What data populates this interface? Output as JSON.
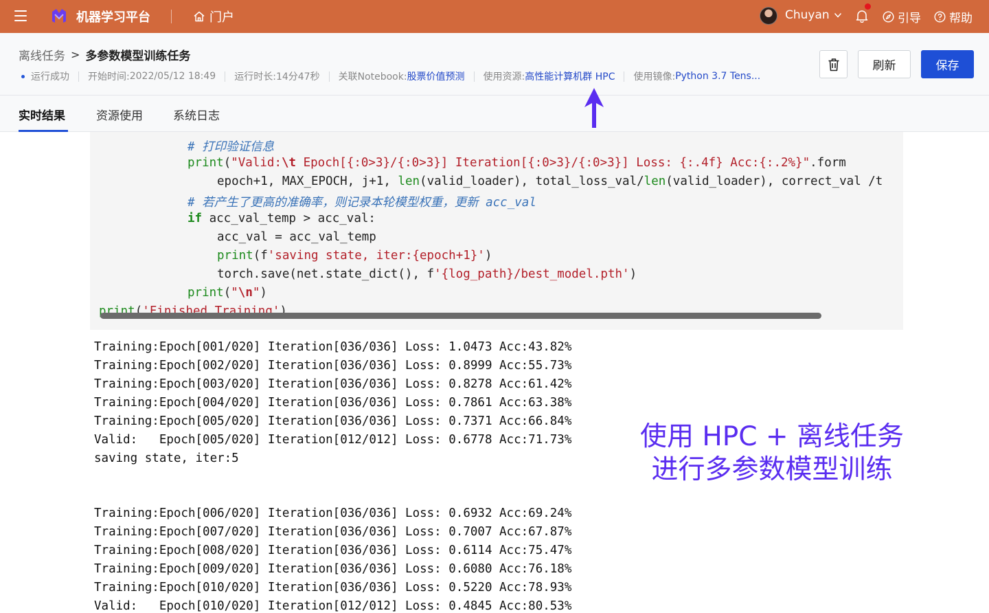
{
  "topbar": {
    "app_title": "机器学习平台",
    "portal_label": "门户",
    "user_name": "Chuyan",
    "guide_label": "引导",
    "help_label": "帮助",
    "accent_color": "#d2693c"
  },
  "header": {
    "breadcrumb_parent": "离线任务",
    "breadcrumb_sep": ">",
    "breadcrumb_current": "多参数模型训练任务",
    "status": "运行成功",
    "start_time_label": "开始时间: ",
    "start_time": "2022/05/12 18:49",
    "duration_label": "运行时长: ",
    "duration": "14分47秒",
    "notebook_label": "关联Notebook: ",
    "notebook": "股票价值预测",
    "resource_label": "使用资源: ",
    "resource": "高性能计算机群 HPC",
    "image_label": "使用镜像: ",
    "image": "Python 3.7 Tens...",
    "refresh_label": "刷新",
    "save_label": "保存"
  },
  "tabs": [
    {
      "label": "实时结果",
      "active": true
    },
    {
      "label": "资源使用",
      "active": false
    },
    {
      "label": "系统日志",
      "active": false
    }
  ],
  "code": {
    "line1": "# 打印验证信息",
    "line2_fn": "print",
    "line2_open": "(",
    "line2_str1": "\"Valid:",
    "line2_esc": "\\t",
    "line2_str2": " Epoch[{:0>3}/{:0>3}] Iteration[{:0>3}/{:0>3}] Loss: {:.4f} Acc:{:.2%}\"",
    "line2_tail": ".form",
    "line3_a": "epoch",
    "line3_b": "+1, MAX_EPOCH, j",
    "line3_c": "+1, ",
    "line3_len1": "len",
    "line3_d": "(valid_loader), total_loss_val/",
    "line3_len2": "len",
    "line3_e": "(valid_loader), correct_val /t",
    "line4": "# 若产生了更高的准确率，则记录本轮模型权重，更新 acc_val",
    "line5_kw": "if",
    "line5_rest": " acc_val_temp > acc_val:",
    "line6": "acc_val = acc_val_temp",
    "line7_fn": "print",
    "line7_open": "(f",
    "line7_str": "'saving state, iter:{epoch+1}'",
    "line7_close": ")",
    "line8_a": "torch.save(net.state_dict(), f",
    "line8_str": "'{log_path}/best_model.pth'",
    "line8_close": ")",
    "line9_fn": "print",
    "line9_open": "(",
    "line9_str1": "\"",
    "line9_esc": "\\n",
    "line9_str2": "\"",
    "line9_close": ")",
    "line10_fn": "print",
    "line10_open": "(",
    "line10_str": "'Finished Training'",
    "line10_close": ")"
  },
  "output": [
    "Training:Epoch[001/020] Iteration[036/036] Loss: 1.0473 Acc:43.82%",
    "Training:Epoch[002/020] Iteration[036/036] Loss: 0.8999 Acc:55.73%",
    "Training:Epoch[003/020] Iteration[036/036] Loss: 0.8278 Acc:61.42%",
    "Training:Epoch[004/020] Iteration[036/036] Loss: 0.7861 Acc:63.38%",
    "Training:Epoch[005/020] Iteration[036/036] Loss: 0.7371 Acc:66.84%",
    "Valid:   Epoch[005/020] Iteration[012/012] Loss: 0.6778 Acc:71.73%",
    "saving state, iter:5",
    "Training:Epoch[006/020] Iteration[036/036] Loss: 0.6932 Acc:69.24%",
    "Training:Epoch[007/020] Iteration[036/036] Loss: 0.7007 Acc:67.87%",
    "Training:Epoch[008/020] Iteration[036/036] Loss: 0.6114 Acc:75.47%",
    "Training:Epoch[009/020] Iteration[036/036] Loss: 0.6080 Acc:76.18%",
    "Training:Epoch[010/020] Iteration[036/036] Loss: 0.5220 Acc:78.93%",
    "Valid:   Epoch[010/020] Iteration[012/012] Loss: 0.4845 Acc:80.53%"
  ],
  "annotation": {
    "line1": "使用 HPC + 离线任务",
    "line2": "进行多参数模型训练",
    "color": "#5a2df0"
  }
}
